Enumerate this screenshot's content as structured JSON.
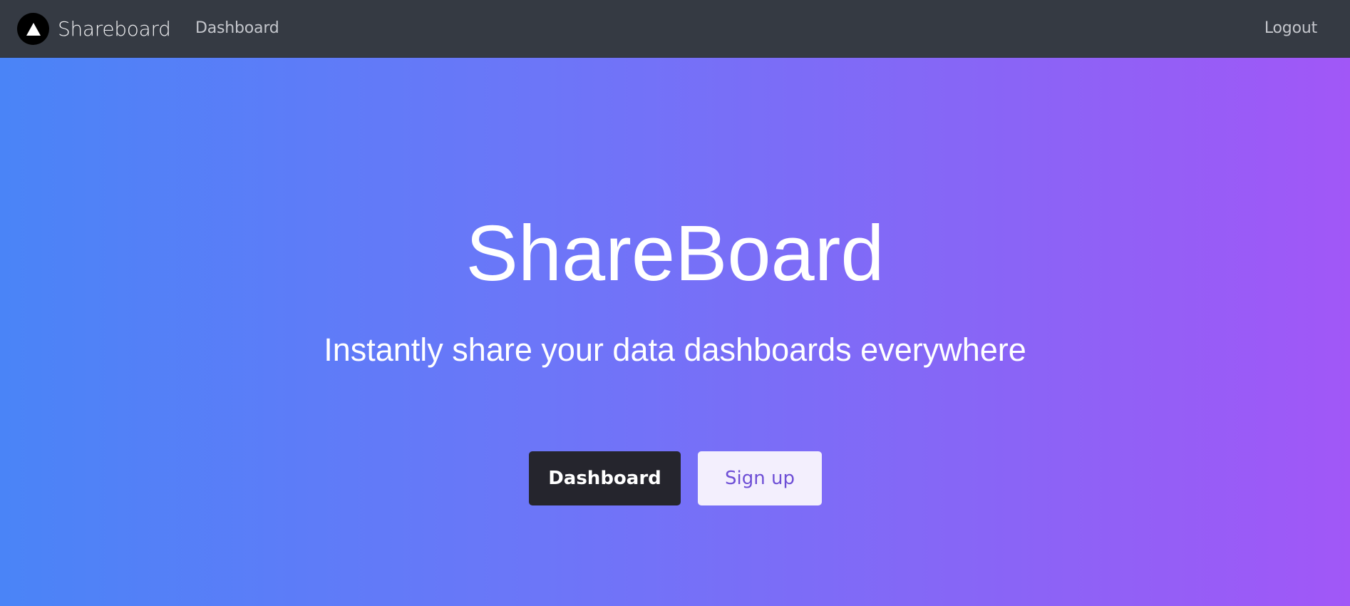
{
  "navbar": {
    "brand_name": "Shareboard",
    "brand_logo_icon": "triangle-icon",
    "links": [
      {
        "label": "Dashboard"
      },
      {
        "label": "Logout"
      }
    ],
    "background_color": "#353a43"
  },
  "hero": {
    "title": "ShareBoard",
    "subtitle": "Instantly share your data dashboards everywhere",
    "gradient": [
      "#4a84f7",
      "#a157f7"
    ],
    "buttons": {
      "primary_label": "Dashboard",
      "secondary_label": "Sign up"
    }
  }
}
